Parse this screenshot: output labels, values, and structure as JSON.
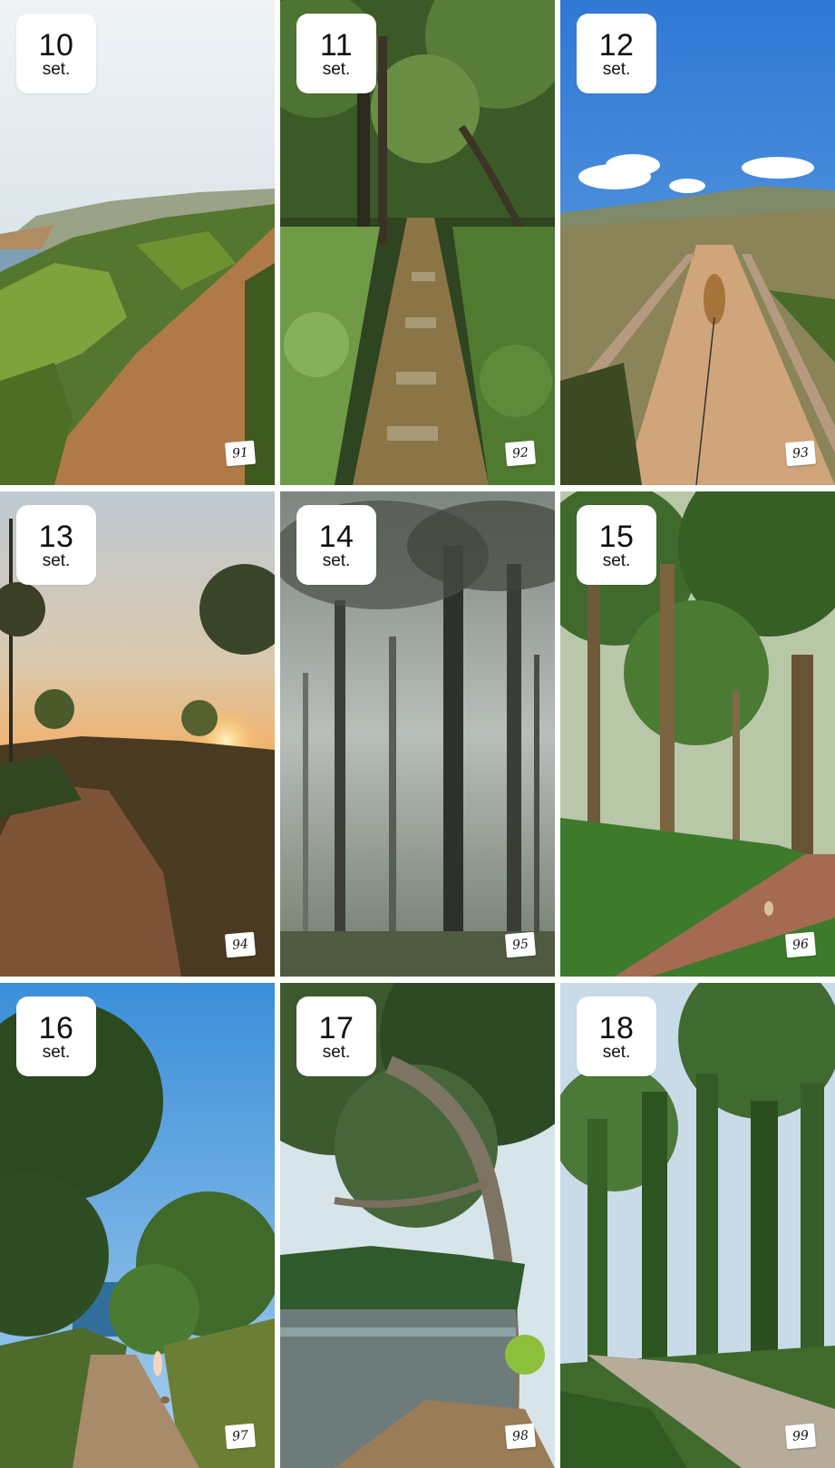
{
  "tiles": [
    {
      "date": "10",
      "month": "set.",
      "sticker": "91",
      "scene": "coastal trail above the sea"
    },
    {
      "date": "11",
      "month": "set.",
      "sticker": "92",
      "scene": "stone path in the forest"
    },
    {
      "date": "12",
      "month": "set.",
      "sticker": "93",
      "scene": "sandy path with dog on a leash"
    },
    {
      "date": "13",
      "month": "set.",
      "sticker": "94",
      "scene": "sunset over a hillside trail"
    },
    {
      "date": "14",
      "month": "set.",
      "sticker": "95",
      "scene": "foggy pine forest"
    },
    {
      "date": "15",
      "month": "set.",
      "sticker": "96",
      "scene": "forest road with tall trees"
    },
    {
      "date": "16",
      "month": "set.",
      "sticker": "97",
      "scene": "trail toward the sea with runner"
    },
    {
      "date": "17",
      "month": "set.",
      "sticker": "98",
      "scene": "lake under a eucalyptus tree"
    },
    {
      "date": "18",
      "month": "set.",
      "sticker": "99",
      "scene": "gravel road in tall forest"
    }
  ]
}
